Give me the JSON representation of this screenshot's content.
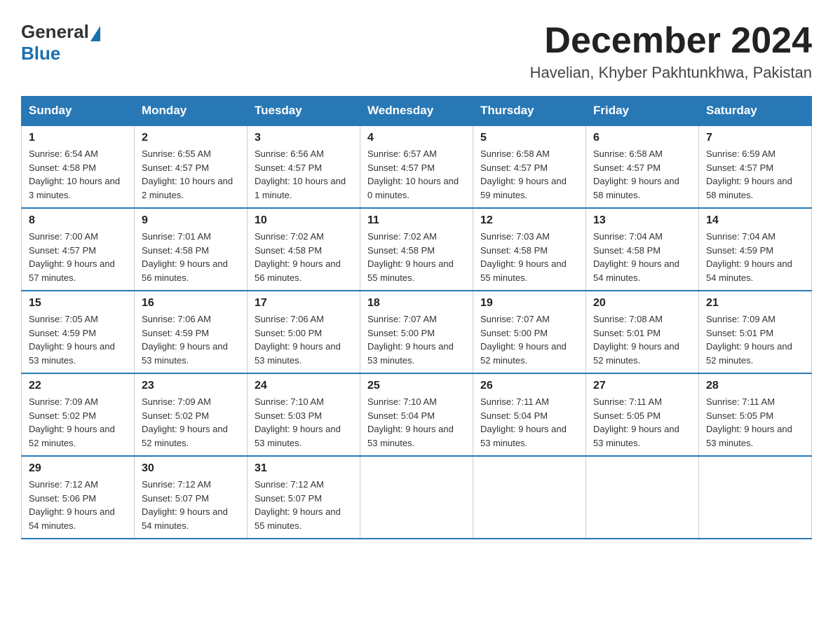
{
  "header": {
    "logo_general": "General",
    "logo_blue": "Blue",
    "month_title": "December 2024",
    "location": "Havelian, Khyber Pakhtunkhwa, Pakistan"
  },
  "days_of_week": [
    "Sunday",
    "Monday",
    "Tuesday",
    "Wednesday",
    "Thursday",
    "Friday",
    "Saturday"
  ],
  "weeks": [
    [
      {
        "day": "1",
        "sunrise": "6:54 AM",
        "sunset": "4:58 PM",
        "daylight": "10 hours and 3 minutes."
      },
      {
        "day": "2",
        "sunrise": "6:55 AM",
        "sunset": "4:57 PM",
        "daylight": "10 hours and 2 minutes."
      },
      {
        "day": "3",
        "sunrise": "6:56 AM",
        "sunset": "4:57 PM",
        "daylight": "10 hours and 1 minute."
      },
      {
        "day": "4",
        "sunrise": "6:57 AM",
        "sunset": "4:57 PM",
        "daylight": "10 hours and 0 minutes."
      },
      {
        "day": "5",
        "sunrise": "6:58 AM",
        "sunset": "4:57 PM",
        "daylight": "9 hours and 59 minutes."
      },
      {
        "day": "6",
        "sunrise": "6:58 AM",
        "sunset": "4:57 PM",
        "daylight": "9 hours and 58 minutes."
      },
      {
        "day": "7",
        "sunrise": "6:59 AM",
        "sunset": "4:57 PM",
        "daylight": "9 hours and 58 minutes."
      }
    ],
    [
      {
        "day": "8",
        "sunrise": "7:00 AM",
        "sunset": "4:57 PM",
        "daylight": "9 hours and 57 minutes."
      },
      {
        "day": "9",
        "sunrise": "7:01 AM",
        "sunset": "4:58 PM",
        "daylight": "9 hours and 56 minutes."
      },
      {
        "day": "10",
        "sunrise": "7:02 AM",
        "sunset": "4:58 PM",
        "daylight": "9 hours and 56 minutes."
      },
      {
        "day": "11",
        "sunrise": "7:02 AM",
        "sunset": "4:58 PM",
        "daylight": "9 hours and 55 minutes."
      },
      {
        "day": "12",
        "sunrise": "7:03 AM",
        "sunset": "4:58 PM",
        "daylight": "9 hours and 55 minutes."
      },
      {
        "day": "13",
        "sunrise": "7:04 AM",
        "sunset": "4:58 PM",
        "daylight": "9 hours and 54 minutes."
      },
      {
        "day": "14",
        "sunrise": "7:04 AM",
        "sunset": "4:59 PM",
        "daylight": "9 hours and 54 minutes."
      }
    ],
    [
      {
        "day": "15",
        "sunrise": "7:05 AM",
        "sunset": "4:59 PM",
        "daylight": "9 hours and 53 minutes."
      },
      {
        "day": "16",
        "sunrise": "7:06 AM",
        "sunset": "4:59 PM",
        "daylight": "9 hours and 53 minutes."
      },
      {
        "day": "17",
        "sunrise": "7:06 AM",
        "sunset": "5:00 PM",
        "daylight": "9 hours and 53 minutes."
      },
      {
        "day": "18",
        "sunrise": "7:07 AM",
        "sunset": "5:00 PM",
        "daylight": "9 hours and 53 minutes."
      },
      {
        "day": "19",
        "sunrise": "7:07 AM",
        "sunset": "5:00 PM",
        "daylight": "9 hours and 52 minutes."
      },
      {
        "day": "20",
        "sunrise": "7:08 AM",
        "sunset": "5:01 PM",
        "daylight": "9 hours and 52 minutes."
      },
      {
        "day": "21",
        "sunrise": "7:09 AM",
        "sunset": "5:01 PM",
        "daylight": "9 hours and 52 minutes."
      }
    ],
    [
      {
        "day": "22",
        "sunrise": "7:09 AM",
        "sunset": "5:02 PM",
        "daylight": "9 hours and 52 minutes."
      },
      {
        "day": "23",
        "sunrise": "7:09 AM",
        "sunset": "5:02 PM",
        "daylight": "9 hours and 52 minutes."
      },
      {
        "day": "24",
        "sunrise": "7:10 AM",
        "sunset": "5:03 PM",
        "daylight": "9 hours and 53 minutes."
      },
      {
        "day": "25",
        "sunrise": "7:10 AM",
        "sunset": "5:04 PM",
        "daylight": "9 hours and 53 minutes."
      },
      {
        "day": "26",
        "sunrise": "7:11 AM",
        "sunset": "5:04 PM",
        "daylight": "9 hours and 53 minutes."
      },
      {
        "day": "27",
        "sunrise": "7:11 AM",
        "sunset": "5:05 PM",
        "daylight": "9 hours and 53 minutes."
      },
      {
        "day": "28",
        "sunrise": "7:11 AM",
        "sunset": "5:05 PM",
        "daylight": "9 hours and 53 minutes."
      }
    ],
    [
      {
        "day": "29",
        "sunrise": "7:12 AM",
        "sunset": "5:06 PM",
        "daylight": "9 hours and 54 minutes."
      },
      {
        "day": "30",
        "sunrise": "7:12 AM",
        "sunset": "5:07 PM",
        "daylight": "9 hours and 54 minutes."
      },
      {
        "day": "31",
        "sunrise": "7:12 AM",
        "sunset": "5:07 PM",
        "daylight": "9 hours and 55 minutes."
      },
      null,
      null,
      null,
      null
    ]
  ]
}
